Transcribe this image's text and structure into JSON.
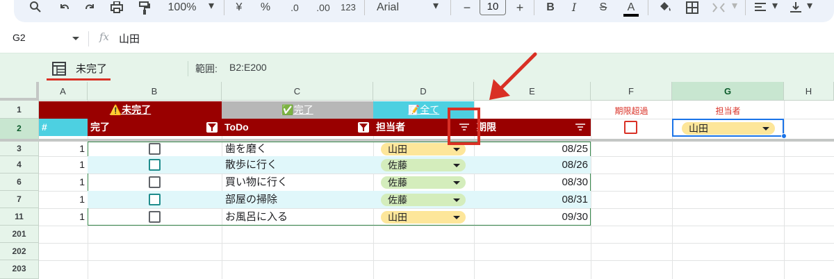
{
  "toolbar": {
    "zoom": "100%",
    "currency": "¥",
    "percent": "%",
    "dec_decrease": ".0",
    "dec_increase": ".00",
    "number_format": "123",
    "font_family": "Arial",
    "font_minus": "−",
    "font_size": "10",
    "font_plus": "+",
    "bold": "B",
    "italic": "I",
    "strike": "S",
    "text_color": "A"
  },
  "formula_bar": {
    "cell_ref": "G2",
    "fx": "fx",
    "value": "山田"
  },
  "filter_view": {
    "name": "未完了",
    "range_label": "範囲:",
    "range": "B2:E200"
  },
  "columns": [
    "A",
    "B",
    "C",
    "D",
    "E",
    "F",
    "G",
    "H"
  ],
  "row_numbers": [
    "1",
    "2",
    "3",
    "4",
    "6",
    "7",
    "11",
    "201",
    "202",
    "203"
  ],
  "tabs": {
    "incomplete": "⚠️未完了",
    "complete": "✅完了",
    "all": "📝全て"
  },
  "side_labels": {
    "overdue": "期限超過",
    "assignee": "担当者"
  },
  "headers": {
    "num": "#",
    "done": "完了",
    "todo": "ToDo",
    "assignee": "担当者",
    "deadline": "期限"
  },
  "assignee_filter": "山田",
  "rows": [
    {
      "num": "1",
      "checked": false,
      "style": "gray",
      "todo": "歯を磨く",
      "assignee": "山田",
      "chip": "yellow",
      "date": "08/25"
    },
    {
      "num": "1",
      "checked": false,
      "style": "teal",
      "todo": "散歩に行く",
      "assignee": "佐藤",
      "chip": "green",
      "date": "08/26"
    },
    {
      "num": "1",
      "checked": false,
      "style": "gray",
      "todo": "買い物に行く",
      "assignee": "佐藤",
      "chip": "green",
      "date": "08/30"
    },
    {
      "num": "1",
      "checked": false,
      "style": "teal",
      "todo": "部屋の掃除",
      "assignee": "佐藤",
      "chip": "green",
      "date": "08/31"
    },
    {
      "num": "1",
      "checked": false,
      "style": "gray",
      "todo": "お風呂に入る",
      "assignee": "山田",
      "chip": "yellow",
      "date": "09/30"
    }
  ],
  "colors": {
    "header_red": "#990000",
    "tab_gray": "#b7b7b7",
    "tab_cyan": "#4dd0e1",
    "alt_row": "#e0f7fa",
    "chip_yellow": "#fde69a",
    "chip_green": "#d4edbc",
    "annotation_red": "#d93025"
  }
}
